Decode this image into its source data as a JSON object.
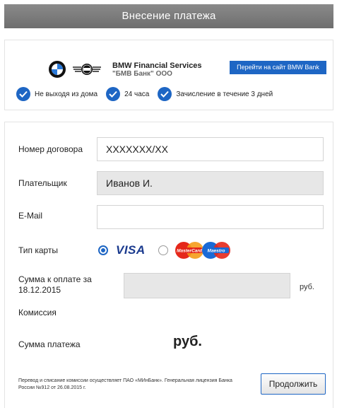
{
  "header": {
    "title": "Внесение платежа"
  },
  "company": {
    "name": "BMW Financial Services",
    "subtitle": "\"БМВ Банк\" ООО",
    "bank_button": "Перейти на сайт BMW Bank"
  },
  "features": [
    {
      "text": "Не выходя из дома"
    },
    {
      "text": "24 часа"
    },
    {
      "text": "Зачисление в течение 3 дней"
    }
  ],
  "form": {
    "contract_label": "Номер договора",
    "contract_value": "XXXXXXX/XX",
    "payer_label": "Плательщик",
    "payer_value": "Иванов И.",
    "email_label": "E-Mail",
    "email_value": "",
    "card_type_label": "Тип карты",
    "card_visa": "VISA",
    "card_mastercard": "MasterCard",
    "card_maestro": "Maestro",
    "amount_label": "Сумма к оплате за 18.12.2015",
    "amount_value": "",
    "amount_currency": "руб.",
    "commission_label": "Комиссия",
    "total_label": "Сумма платежа",
    "total_value": "руб."
  },
  "footer": {
    "note": "Перевод и списание комиссии осуществляет ПАО «МИнБанк». Генеральная лицензия Банка России №912 от 26.08.2015 г.",
    "continue_button": "Продолжить"
  },
  "colors": {
    "accent": "#1e66c4",
    "header_bg": "#7a7a7a",
    "disabled_bg": "#e7e7e7"
  }
}
